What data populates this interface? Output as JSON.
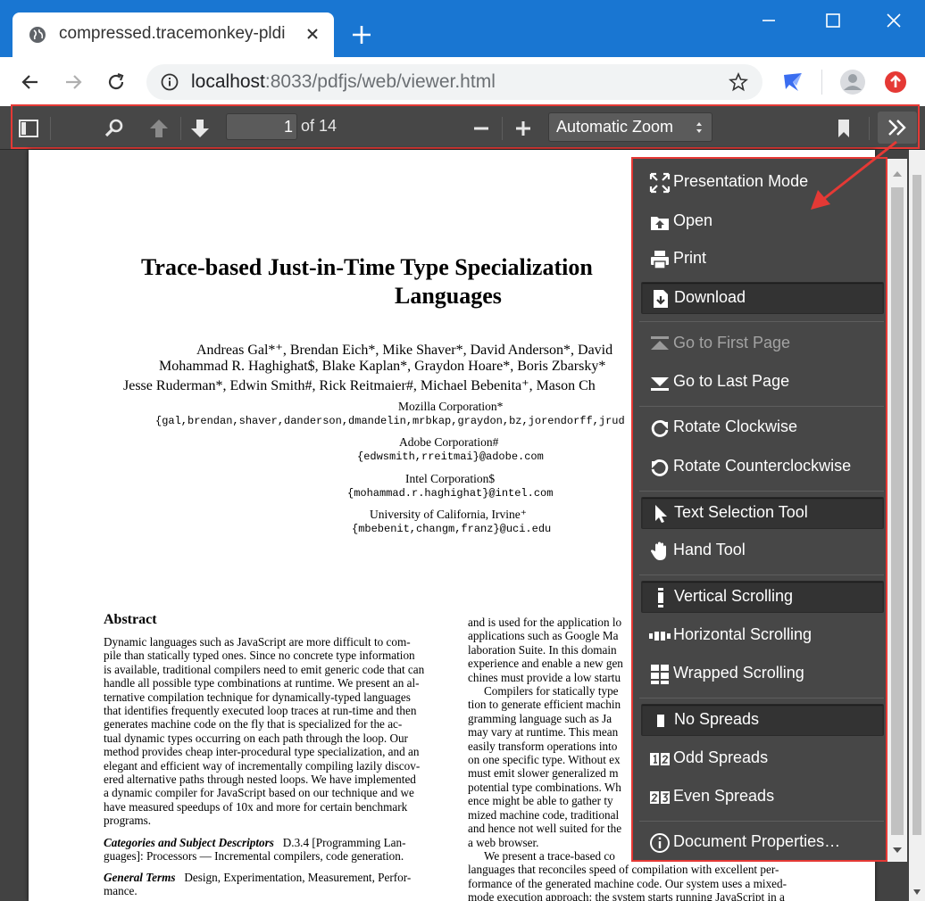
{
  "browser": {
    "tab_title": "compressed.tracemonkey-pldi",
    "url_host": "localhost",
    "url_rest": ":8033/pdfjs/web/viewer.html",
    "colors": {
      "titlebar": "#1976d2",
      "annotation": "#e53935"
    }
  },
  "toolbar": {
    "page_number": "1",
    "page_count": "of 14",
    "zoom": "Automatic Zoom"
  },
  "menu": {
    "presentation_mode": "Presentation Mode",
    "open": "Open",
    "print": "Print",
    "download": "Download",
    "first_page": "Go to First Page",
    "last_page": "Go to Last Page",
    "rotate_cw": "Rotate Clockwise",
    "rotate_ccw": "Rotate Counterclockwise",
    "text_selection": "Text Selection Tool",
    "hand_tool": "Hand Tool",
    "vertical_scrolling": "Vertical Scrolling",
    "horizontal_scrolling": "Horizontal Scrolling",
    "wrapped_scrolling": "Wrapped Scrolling",
    "no_spreads": "No Spreads",
    "odd_spreads": "Odd Spreads",
    "even_spreads": "Even Spreads",
    "document_properties": "Document Properties…"
  },
  "document": {
    "title_line1": "Trace-based Just-in-Time Type Specialization",
    "title_line2": "Languages",
    "authors": [
      "Andreas Gal*⁺, Brendan Eich*, Mike Shaver*, David Anderson*, David",
      "Mohammad R. Haghighat$, Blake Kaplan*, Graydon Hoare*, Boris Zbarsky*",
      "Jesse Ruderman*, Edwin Smith#, Rick Reitmaier#, Michael Bebenita⁺, Mason Ch"
    ],
    "affiliations": [
      {
        "org": "Mozilla Corporation*",
        "email": "{gal,brendan,shaver,danderson,dmandelin,mrbkap,graydon,bz,jorendorff,jrud"
      },
      {
        "org": "Adobe Corporation#",
        "email": "{edwsmith,rreitmai}@adobe.com"
      },
      {
        "org": "Intel Corporation$",
        "email": "{mohammad.r.haghighat}@intel.com"
      },
      {
        "org": "University of California, Irvine⁺",
        "email": "{mbebenit,changm,franz}@uci.edu"
      }
    ],
    "abstract_heading": "Abstract",
    "left_column": [
      "Dynamic languages such as JavaScript are more difficult to com-",
      "pile than statically typed ones. Since no concrete type information",
      "is available, traditional compilers need to emit generic code that can",
      "handle all possible type combinations at runtime. We present an al-",
      "ternative compilation technique for dynamically-typed languages",
      "that identifies frequently executed loop traces at run-time and then",
      "generates machine code on the fly that is specialized for the ac-",
      "tual dynamic types occurring on each path through the loop. Our",
      "method provides cheap inter-procedural type specialization, and an",
      "elegant and efficient way of incrementally compiling lazily discov-",
      "ered alternative paths through nested loops. We have implemented",
      "a dynamic compiler for JavaScript based on our technique and we",
      "have measured speedups of 10x and more for certain benchmark",
      "programs."
    ],
    "categories_label": "Categories and Subject Descriptors",
    "categories_text1": "D.3.4 [Programming Lan-",
    "categories_text2": "guages]: Processors — Incremental compilers, code generation.",
    "general_label": "General Terms",
    "general_text1": "Design, Experimentation, Measurement, Perfor-",
    "general_text2": "mance.",
    "right_column": [
      "and is used for the application lo",
      "applications such as Google Ma",
      "laboration Suite. In this domain",
      "experience and enable a new gen",
      "chines must provide a low startu",
      "Compilers for statically type",
      "tion to generate efficient machin",
      "gramming language such as Ja",
      "may vary at runtime. This mean",
      "easily transform operations into",
      "on one specific type. Without ex",
      "must emit slower generalized m",
      "potential type combinations. Wh",
      "ence might be able to gather ty",
      "mized machine code, traditional",
      "and hence not well suited for the",
      "a web browser.",
      "We present a trace-based co",
      "languages that reconciles speed of compilation with excellent per-",
      "formance of the generated machine code. Our system uses a mixed-",
      "mode execution approach: the system starts running JavaScript in a"
    ]
  }
}
